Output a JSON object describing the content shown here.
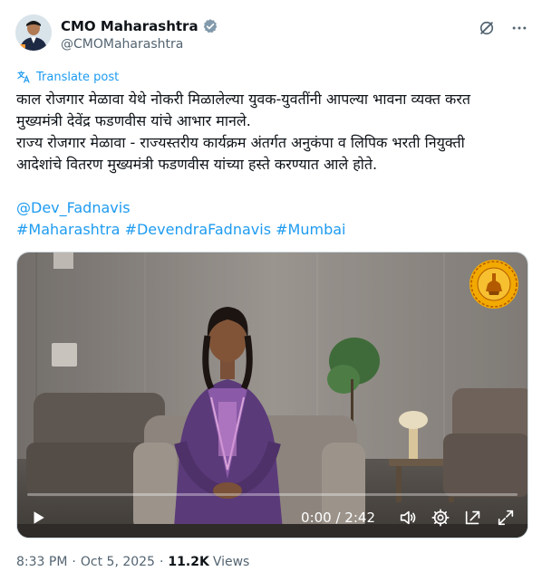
{
  "author": {
    "display_name": "CMO Maharashtra",
    "handle": "@CMOMaharashtra",
    "verified_icon": "verified-badge-icon"
  },
  "actions": {
    "grok_icon": "grok-icon",
    "more_icon": "more-icon"
  },
  "translate": {
    "label": "Translate post"
  },
  "post": {
    "line1": "काल रोजगार मेळावा येथे नोकरी मिळालेल्या युवक-युवतींनी आपल्या भावना व्यक्त करत",
    "line2": "मुख्यमंत्री देवेंद्र फडणवीस यांचे आभार मानले.",
    "line3": "राज्य रोजगार मेळावा - राज्यस्तरीय कार्यक्रम अंतर्गत अनुकंपा व लिपिक भरती नियुक्ती",
    "line4": "आदेशांचे वितरण मुख्यमंत्री फडणवीस यांच्या हस्ते करण्यात आले होते.",
    "mention": "@Dev_Fadnavis",
    "hashtag1": "#Maharashtra",
    "hashtag2": "#DevendraFadnavis",
    "hashtag3": "#Mumbai"
  },
  "video": {
    "time": "0:00 / 2:42",
    "progress": 0.0,
    "emblem_icon": "maharashtra-emblem-icon"
  },
  "meta": {
    "time": "8:33 PM",
    "separator": "·",
    "date": "Oct 5, 2025",
    "views_count": "11.2K",
    "views_label": "Views"
  },
  "colors": {
    "link": "#1d9bf0",
    "text": "#0f1419",
    "secondary": "#536471"
  }
}
